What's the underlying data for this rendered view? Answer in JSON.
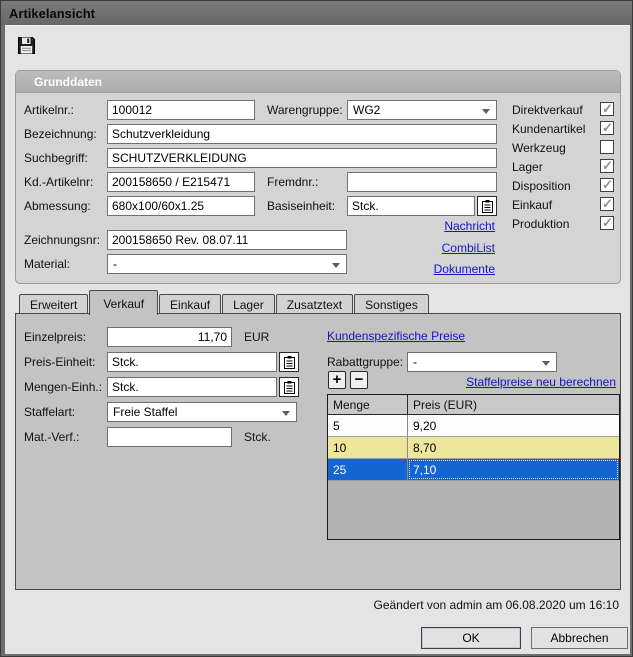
{
  "window": {
    "title": "Artikelansicht"
  },
  "toolbar": {
    "save_tooltip": "Speichern"
  },
  "grunddaten": {
    "title": "Grunddaten",
    "fields": {
      "artikelnr": {
        "label": "Artikelnr.:",
        "value": "100012"
      },
      "warengruppe": {
        "label": "Warengruppe:",
        "value": "WG2"
      },
      "bezeichnung": {
        "label": "Bezeichnung:",
        "value": "Schutzverkleidung"
      },
      "suchbegriff": {
        "label": "Suchbegriff:",
        "value": "SCHUTZVERKLEIDUNG"
      },
      "kd_artikelnr": {
        "label": "Kd.-Artikelnr:",
        "value": "200158650 / E215471"
      },
      "fremdnr": {
        "label": "Fremdnr.:",
        "value": ""
      },
      "abmessung": {
        "label": "Abmessung:",
        "value": "680x100/60x1.25"
      },
      "basiseinheit": {
        "label": "Basiseinheit:",
        "value": "Stck."
      },
      "zeichnungsnr": {
        "label": "Zeichnungsnr:",
        "value": "200158650 Rev. 08.07.11"
      },
      "material": {
        "label": "Material:",
        "value": "-"
      }
    },
    "links": [
      {
        "label": "Nachricht"
      },
      {
        "label": "CombiList"
      },
      {
        "label": "Dokumente"
      }
    ],
    "checkboxes": [
      {
        "label": "Direktverkauf",
        "checked": true
      },
      {
        "label": "Kundenartikel",
        "checked": true
      },
      {
        "label": "Werkzeug",
        "checked": false
      },
      {
        "label": "Lager",
        "checked": true
      },
      {
        "label": "Disposition",
        "checked": true
      },
      {
        "label": "Einkauf",
        "checked": true
      },
      {
        "label": "Produktion",
        "checked": true
      }
    ]
  },
  "tabs": {
    "selected": "Verkauf",
    "items": [
      {
        "label": "Erweitert"
      },
      {
        "label": "Verkauf"
      },
      {
        "label": "Einkauf"
      },
      {
        "label": "Lager"
      },
      {
        "label": "Zusatztext"
      },
      {
        "label": "Sonstiges"
      }
    ]
  },
  "verkauf": {
    "einzelpreis": {
      "label": "Einzelpreis:",
      "value": "11,70",
      "unit": "EUR"
    },
    "preis_einheit": {
      "label": "Preis-Einheit:",
      "value": "Stck."
    },
    "mengen_einheit": {
      "label": "Mengen-Einh.:",
      "value": "Stck."
    },
    "staffelart": {
      "label": "Staffelart:",
      "value": "Freie Staffel"
    },
    "mat_verf": {
      "label": "Mat.-Verf.:",
      "value": "",
      "unit": "Stck."
    },
    "kundenspezifische_preise_link": "Kundenspezifische Preise",
    "rabattgruppe": {
      "label": "Rabattgruppe:",
      "value": "-"
    },
    "staffelpreise_link": "Staffelpreise neu berechnen",
    "add_button": "+",
    "remove_button": "−",
    "staffel_table": {
      "columns": [
        "Menge",
        "Preis (EUR)"
      ],
      "rows": [
        {
          "menge": "5",
          "preis": "9,20",
          "state": "normal"
        },
        {
          "menge": "10",
          "preis": "8,70",
          "state": "highlight"
        },
        {
          "menge": "25",
          "preis": "7,10",
          "state": "selected"
        }
      ]
    }
  },
  "footer": {
    "status": "Geändert von admin am 06.08.2020 um 16:10",
    "ok_label": "OK",
    "cancel_label": "Abbrechen"
  },
  "colors": {
    "link": "#1414c8",
    "row_highlight": "#ece79a",
    "row_selected": "#1464d2"
  }
}
